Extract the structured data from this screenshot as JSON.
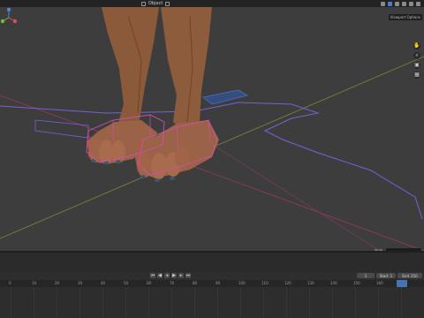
{
  "header": {
    "mode_label": "Object"
  },
  "viewport": {
    "menu_label": "Viewport Options",
    "gizmo": {
      "x_color": "#e04c4c",
      "y_color": "#79b63d",
      "z_color": "#4e86d8"
    },
    "tool_icons": [
      "hand-icon",
      "zoom-icon",
      "camera-icon",
      "grid-icon"
    ]
  },
  "timeline": {
    "current_frame": "1",
    "start_label": "Start",
    "start_value": "1",
    "end_label": "End",
    "end_value": "250",
    "ruler_ticks": [
      "0",
      "10",
      "20",
      "30",
      "40",
      "50",
      "60",
      "70",
      "80",
      "90",
      "100",
      "110",
      "120",
      "130",
      "140",
      "150",
      "160",
      "170"
    ]
  },
  "colors": {
    "background": "#3d3d3d",
    "header": "#232323",
    "selection_outline": "#c040c0",
    "accent": "#4772b3"
  }
}
